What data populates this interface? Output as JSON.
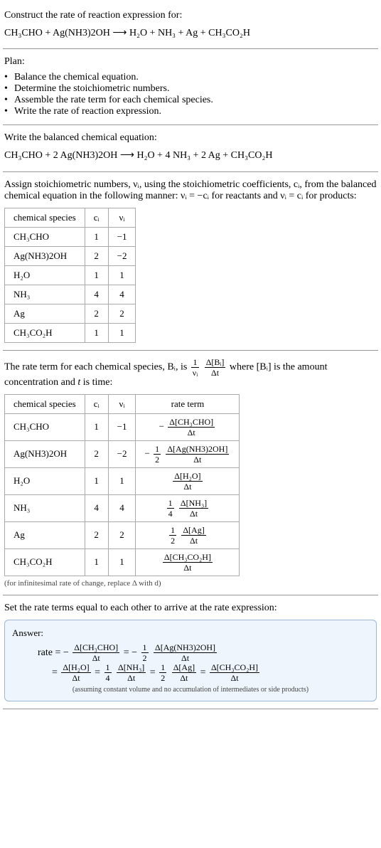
{
  "intro": {
    "heading": "Construct the rate of reaction expression for:",
    "equation": "CH₃CHO + Ag(NH3)2OH ⟶ H₂O + NH₃ + Ag + CH₃CO₂H"
  },
  "plan": {
    "heading": "Plan:",
    "items": [
      "Balance the chemical equation.",
      "Determine the stoichiometric numbers.",
      "Assemble the rate term for each chemical species.",
      "Write the rate of reaction expression."
    ]
  },
  "balanced": {
    "heading": "Write the balanced chemical equation:",
    "equation": "CH₃CHO + 2 Ag(NH3)2OH ⟶ H₂O + 4 NH₃ + 2 Ag + CH₃CO₂H"
  },
  "stoich": {
    "heading_a": "Assign stoichiometric numbers, νᵢ, using the stoichiometric coefficients, cᵢ, from the balanced chemical equation in the following manner: νᵢ = −cᵢ for reactants and νᵢ = cᵢ for products:",
    "headers": [
      "chemical species",
      "cᵢ",
      "νᵢ"
    ],
    "rows": [
      {
        "s": "CH₃CHO",
        "c": "1",
        "v": "−1"
      },
      {
        "s": "Ag(NH3)2OH",
        "c": "2",
        "v": "−2"
      },
      {
        "s": "H₂O",
        "c": "1",
        "v": "1"
      },
      {
        "s": "NH₃",
        "c": "4",
        "v": "4"
      },
      {
        "s": "Ag",
        "c": "2",
        "v": "2"
      },
      {
        "s": "CH₃CO₂H",
        "c": "1",
        "v": "1"
      }
    ]
  },
  "rate_terms": {
    "heading_prefix": "The rate term for each chemical species, Bᵢ, is ",
    "frac1_num": "1",
    "frac1_den": "νᵢ",
    "frac2_num": "Δ[Bᵢ]",
    "frac2_den": "Δt",
    "heading_mid": " where [Bᵢ] is the amount concentration and ",
    "heading_time": "t",
    "heading_suffix": " is time:",
    "headers": [
      "chemical species",
      "cᵢ",
      "νᵢ",
      "rate term"
    ],
    "rows": [
      {
        "s": "CH₃CHO",
        "c": "1",
        "v": "−1",
        "prefix": "−",
        "coef_num": "",
        "coef_den": "",
        "num": "Δ[CH₃CHO]",
        "den": "Δt"
      },
      {
        "s": "Ag(NH3)2OH",
        "c": "2",
        "v": "−2",
        "prefix": "−",
        "coef_num": "1",
        "coef_den": "2",
        "num": "Δ[Ag(NH3)2OH]",
        "den": "Δt"
      },
      {
        "s": "H₂O",
        "c": "1",
        "v": "1",
        "prefix": "",
        "coef_num": "",
        "coef_den": "",
        "num": "Δ[H₂O]",
        "den": "Δt"
      },
      {
        "s": "NH₃",
        "c": "4",
        "v": "4",
        "prefix": "",
        "coef_num": "1",
        "coef_den": "4",
        "num": "Δ[NH₃]",
        "den": "Δt"
      },
      {
        "s": "Ag",
        "c": "2",
        "v": "2",
        "prefix": "",
        "coef_num": "1",
        "coef_den": "2",
        "num": "Δ[Ag]",
        "den": "Δt"
      },
      {
        "s": "CH₃CO₂H",
        "c": "1",
        "v": "1",
        "prefix": "",
        "coef_num": "",
        "coef_den": "",
        "num": "Δ[CH₃CO₂H]",
        "den": "Δt"
      }
    ],
    "note": "(for infinitesimal rate of change, replace Δ with d)"
  },
  "final": {
    "heading": "Set the rate terms equal to each other to arrive at the rate expression:",
    "answer_title": "Answer:",
    "rate_label": "rate = ",
    "equals": " = ",
    "minus": "−",
    "line2_prefix": "= ",
    "terms": {
      "t1": {
        "num": "Δ[CH₃CHO]",
        "den": "Δt"
      },
      "c2": {
        "num": "1",
        "den": "2"
      },
      "t2": {
        "num": "Δ[Ag(NH3)2OH]",
        "den": "Δt"
      },
      "t3": {
        "num": "Δ[H₂O]",
        "den": "Δt"
      },
      "c4": {
        "num": "1",
        "den": "4"
      },
      "t4": {
        "num": "Δ[NH₃]",
        "den": "Δt"
      },
      "c5": {
        "num": "1",
        "den": "2"
      },
      "t5": {
        "num": "Δ[Ag]",
        "den": "Δt"
      },
      "t6": {
        "num": "Δ[CH₃CO₂H]",
        "den": "Δt"
      }
    },
    "note": "(assuming constant volume and no accumulation of intermediates or side products)"
  }
}
